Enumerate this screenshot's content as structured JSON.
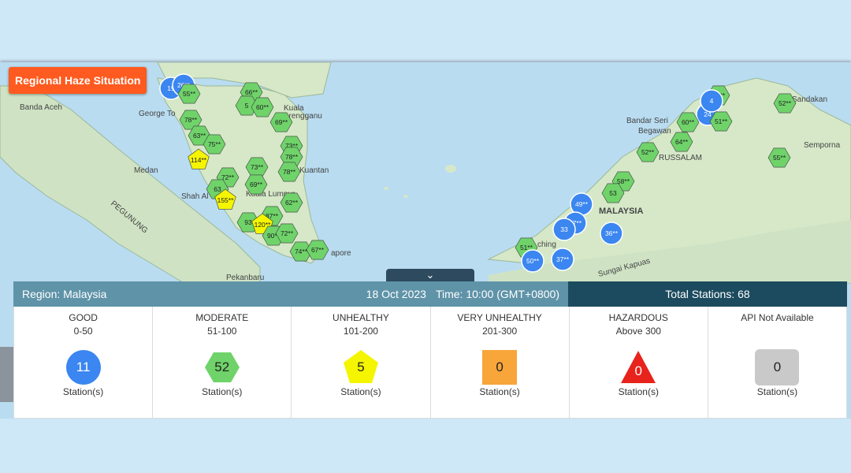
{
  "title": "Regional Haze Situation",
  "map": {
    "place_labels": [
      "Banda Aceh",
      "George To",
      "Medan",
      "Shah Al",
      "Kuala",
      "Terengganu",
      "Kuantan",
      "Kuala Lumpur",
      "apore",
      "Pekanbaru",
      "PEGUNUNG",
      "Bandar Seri",
      "Begawan",
      "RUSSALAM",
      "Sandakan",
      "Semporna",
      "MALAYSIA",
      "ching",
      "Sungai Kapuas"
    ],
    "colors": {
      "good": "#3b86f0",
      "moderate": "#6fd36a",
      "unhealthy": "#f5f500",
      "very_unhealthy": "#f8a53a",
      "hazardous": "#e8231c",
      "na": "#c9c9c9"
    },
    "markers": [
      {
        "label": "19",
        "cat": "good"
      },
      {
        "label": "26**",
        "cat": "good"
      },
      {
        "label": "55**",
        "cat": "moderate"
      },
      {
        "label": "78**",
        "cat": "moderate"
      },
      {
        "label": "63**",
        "cat": "moderate"
      },
      {
        "label": "75**",
        "cat": "moderate"
      },
      {
        "label": "114**",
        "cat": "unhealthy"
      },
      {
        "label": "66**",
        "cat": "moderate"
      },
      {
        "label": "5",
        "cat": "moderate"
      },
      {
        "label": "60**",
        "cat": "moderate"
      },
      {
        "label": "69**",
        "cat": "moderate"
      },
      {
        "label": "73**",
        "cat": "moderate"
      },
      {
        "label": "78**",
        "cat": "moderate"
      },
      {
        "label": "78**",
        "cat": "moderate"
      },
      {
        "label": "73**",
        "cat": "moderate"
      },
      {
        "label": "72**",
        "cat": "moderate"
      },
      {
        "label": "69**",
        "cat": "moderate"
      },
      {
        "label": "63",
        "cat": "moderate"
      },
      {
        "label": "155**",
        "cat": "unhealthy"
      },
      {
        "label": "62**",
        "cat": "moderate"
      },
      {
        "label": "87**",
        "cat": "moderate"
      },
      {
        "label": "93",
        "cat": "moderate"
      },
      {
        "label": "120**",
        "cat": "unhealthy"
      },
      {
        "label": "90**",
        "cat": "moderate"
      },
      {
        "label": "72**",
        "cat": "moderate"
      },
      {
        "label": "74**",
        "cat": "moderate"
      },
      {
        "label": "67**",
        "cat": "moderate"
      },
      {
        "label": "63**",
        "cat": "moderate"
      },
      {
        "label": "52**",
        "cat": "moderate"
      },
      {
        "label": "24",
        "cat": "good"
      },
      {
        "label": "60**",
        "cat": "moderate"
      },
      {
        "label": "51**",
        "cat": "moderate"
      },
      {
        "label": "64**",
        "cat": "moderate"
      },
      {
        "label": "52**",
        "cat": "moderate"
      },
      {
        "label": "55**",
        "cat": "moderate"
      },
      {
        "label": "58**",
        "cat": "moderate"
      },
      {
        "label": "53",
        "cat": "moderate"
      },
      {
        "label": "49**",
        "cat": "good"
      },
      {
        "label": "47**",
        "cat": "good"
      },
      {
        "label": "33",
        "cat": "good"
      },
      {
        "label": "36**",
        "cat": "good"
      },
      {
        "label": "51**",
        "cat": "moderate"
      },
      {
        "label": "50**",
        "cat": "good"
      },
      {
        "label": "37**",
        "cat": "good"
      },
      {
        "label": "4",
        "cat": "good"
      }
    ]
  },
  "panel": {
    "region": "Region: Malaysia",
    "date": "18 Oct 2023",
    "time": "Time: 10:00 (GMT+0800)",
    "total": "Total Stations: 68",
    "categories": [
      {
        "name": "GOOD",
        "range": "0-50",
        "count": "11",
        "unit": "Station(s)",
        "shape": "circle"
      },
      {
        "name": "MODERATE",
        "range": "51-100",
        "count": "52",
        "unit": "Station(s)",
        "shape": "hexagon"
      },
      {
        "name": "UNHEALTHY",
        "range": "101-200",
        "count": "5",
        "unit": "Station(s)",
        "shape": "pentagon"
      },
      {
        "name": "VERY UNHEALTHY",
        "range": "201-300",
        "count": "0",
        "unit": "Station(s)",
        "shape": "square"
      },
      {
        "name": "HAZARDOUS",
        "range": "Above 300",
        "count": "0",
        "unit": "Station(s)",
        "shape": "triangle"
      },
      {
        "name": "API Not Available",
        "range": "",
        "count": "0",
        "unit": "Station(s)",
        "shape": "rounded-square"
      }
    ]
  }
}
